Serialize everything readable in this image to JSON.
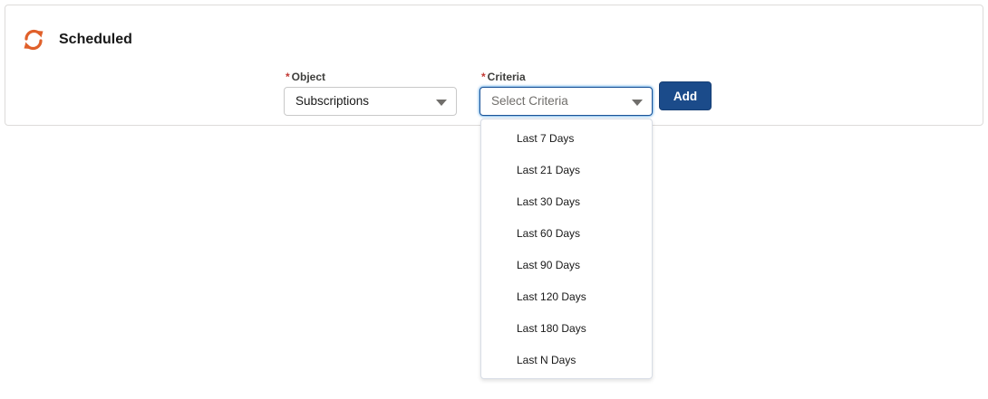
{
  "header": {
    "icon": "refresh-icon",
    "icon_color": "#e0602a",
    "title": "Scheduled"
  },
  "object_field": {
    "required_marker": "*",
    "label": "Object",
    "value": "Subscriptions"
  },
  "criteria_field": {
    "required_marker": "*",
    "label": "Criteria",
    "placeholder": "Select Criteria",
    "options": [
      "Last 7 Days",
      "Last 21 Days",
      "Last 30 Days",
      "Last 60 Days",
      "Last 90 Days",
      "Last 120 Days",
      "Last 180 Days",
      "Last N Days"
    ]
  },
  "add_button": {
    "label": "Add",
    "color": "#1b4b8a"
  }
}
